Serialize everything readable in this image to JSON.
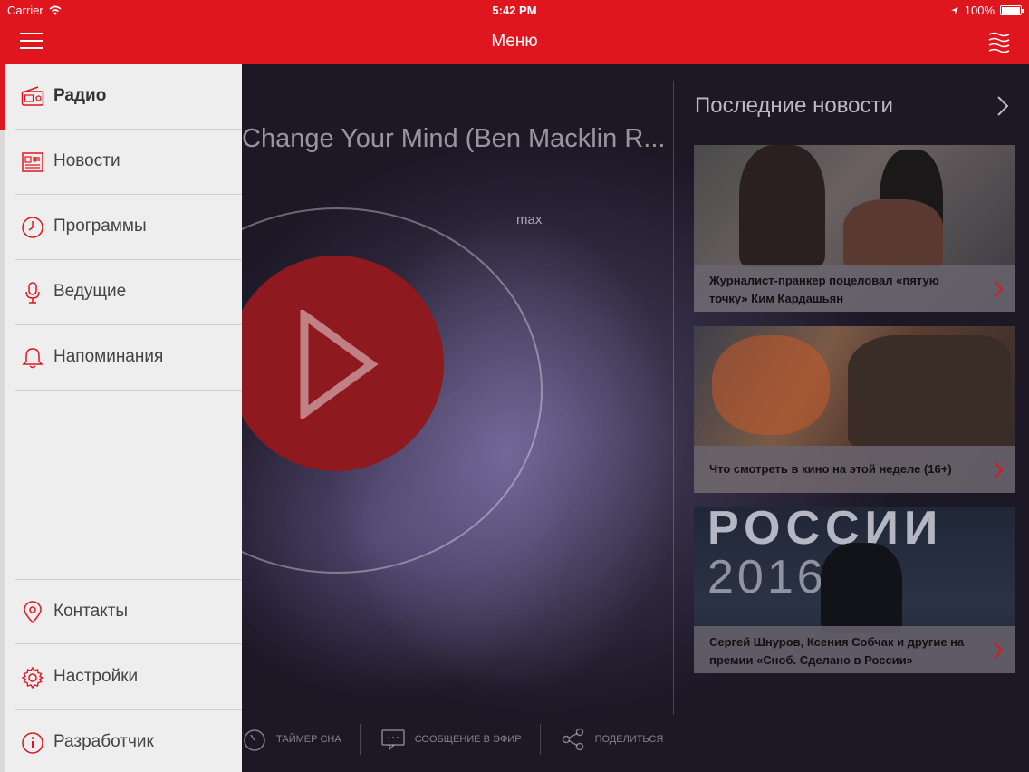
{
  "status_bar": {
    "carrier": "Carrier",
    "time": "5:42 PM",
    "battery": "100%",
    "battery_level": 1.0
  },
  "header": {
    "title": "Меню",
    "menu_icon": "hamburger-icon",
    "right_icon": "waves-icon"
  },
  "menu": {
    "items": [
      {
        "label": "Радио",
        "icon": "radio-icon",
        "active": true
      },
      {
        "label": "Новости",
        "icon": "newspaper-icon"
      },
      {
        "label": "Программы",
        "icon": "clock-icon"
      },
      {
        "label": "Ведущие",
        "icon": "microphone-icon"
      },
      {
        "label": "Напоминания",
        "icon": "bell-icon"
      }
    ],
    "bottom_items": [
      {
        "label": "Контакты",
        "icon": "location-pin-icon"
      },
      {
        "label": "Настройки",
        "icon": "gear-icon"
      },
      {
        "label": "Разработчик",
        "icon": "info-icon"
      }
    ]
  },
  "player": {
    "track_title": "Change Your Mind (Ben Macklin R...",
    "volume_label": "max",
    "tools": [
      {
        "label": "ТАЙМЕР СНА",
        "icon": "timer-icon"
      },
      {
        "label": "СООБЩЕНИЕ В ЭФИР",
        "icon": "message-icon"
      },
      {
        "label": "ПОДЕЛИТЬСЯ",
        "icon": "share-icon"
      }
    ]
  },
  "news": {
    "heading": "Последние новости",
    "items": [
      {
        "caption": "Журналист-пранкер поцеловал «пятую точку» Ким Кардашьян"
      },
      {
        "caption": "Что смотреть в кино на этой неделе (16+)"
      },
      {
        "caption": "Сергей Шнуров, Ксения Собчак и другие на премии «Сноб. Сделано в России»",
        "image_text_1": "РОССИИ",
        "image_text_2": "2016"
      }
    ]
  },
  "colors": {
    "accent": "#e0161f",
    "menu_bg": "#eeeeee",
    "play_button": "#8e1a20"
  }
}
